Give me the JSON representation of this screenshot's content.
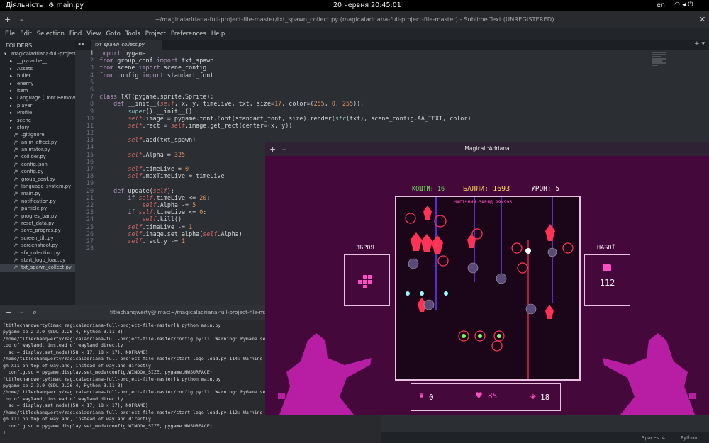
{
  "topbar": {
    "activities": "Діяльність",
    "app": "main.py",
    "clock": "20 червня  20:45:01",
    "lang": "en",
    "tray": "wifi speaker power"
  },
  "sublime": {
    "title": "~/magicaladriana-full-project-file-master/txt_spawn_collect.py (magicaladriana-full-project-file-master) - Sublime Text (UNREGISTERED)",
    "menu": [
      "File",
      "Edit",
      "Selection",
      "Find",
      "View",
      "Goto",
      "Tools",
      "Project",
      "Preferences",
      "Help"
    ],
    "sidebar_header": "FOLDERS",
    "tree": [
      {
        "label": "magicaladriana-full-project-f",
        "icon": "▾",
        "indent": 6
      },
      {
        "label": "__pycache__",
        "icon": "▸",
        "indent": 14
      },
      {
        "label": "Assets",
        "icon": "▸",
        "indent": 14
      },
      {
        "label": "bullet",
        "icon": "▸",
        "indent": 14
      },
      {
        "label": "enemy",
        "icon": "▸",
        "indent": 14
      },
      {
        "label": "item",
        "icon": "▸",
        "indent": 14
      },
      {
        "label": "Language (Dont Remove)",
        "icon": "▸",
        "indent": 14
      },
      {
        "label": "player",
        "icon": "▸",
        "indent": 14
      },
      {
        "label": "Profile",
        "icon": "▸",
        "indent": 14
      },
      {
        "label": "scene",
        "icon": "▸",
        "indent": 14
      },
      {
        "label": "story",
        "icon": "▸",
        "indent": 14
      },
      {
        "label": ".gitignore",
        "icon": "/*",
        "indent": 20
      },
      {
        "label": "anim_effect.py",
        "icon": "/*",
        "indent": 20
      },
      {
        "label": "animator.py",
        "icon": "/*",
        "indent": 20
      },
      {
        "label": "collider.py",
        "icon": "/*",
        "indent": 20
      },
      {
        "label": "config.json",
        "icon": "/*",
        "indent": 20
      },
      {
        "label": "config.py",
        "icon": "/*",
        "indent": 20
      },
      {
        "label": "group_conf.py",
        "icon": "/*",
        "indent": 20
      },
      {
        "label": "language_system.py",
        "icon": "/*",
        "indent": 20
      },
      {
        "label": "main.py",
        "icon": "/*",
        "indent": 20
      },
      {
        "label": "notification.py",
        "icon": "/*",
        "indent": 20
      },
      {
        "label": "particle.py",
        "icon": "/*",
        "indent": 20
      },
      {
        "label": "progres_bar.py",
        "icon": "/*",
        "indent": 20
      },
      {
        "label": "reset_data.py",
        "icon": "/*",
        "indent": 20
      },
      {
        "label": "save_progres.py",
        "icon": "/*",
        "indent": 20
      },
      {
        "label": "screen_tilt.py",
        "icon": "/*",
        "indent": 20
      },
      {
        "label": "screenshoot.py",
        "icon": "/*",
        "indent": 20
      },
      {
        "label": "sfx_colection.py",
        "icon": "/*",
        "indent": 20
      },
      {
        "label": "start_logo_load.py",
        "icon": "/*",
        "indent": 20
      },
      {
        "label": "txt_spawn_collect.py",
        "icon": "/*",
        "indent": 20,
        "selected": true
      }
    ],
    "tab": "txt_spawn_collect.py",
    "line_numbers": [
      "1",
      "2",
      "3",
      "4",
      "5",
      "6",
      "7",
      "8",
      "9",
      "10",
      "11",
      "12",
      "13",
      "14",
      "15",
      "16",
      "17",
      "18",
      "19",
      "20",
      "21",
      "22",
      "23",
      "24",
      "25",
      "26",
      "27",
      "28"
    ],
    "code": [
      "import pygame",
      "from group_conf import txt_spawn",
      "from scene import scene_config",
      "from config import standart_font",
      "",
      "",
      "class TXT(pygame.sprite.Sprite):",
      "    def __init__(self, x, y, timeLive, txt, size=17, color=(255, 0, 255)):",
      "        super().__init__()",
      "        self.image = pygame.font.Font(standart_font, size).render(str(txt), scene_config.AA_TEXT, color)",
      "        self.rect = self.image.get_rect(center=(x, y))",
      "",
      "        self.add(txt_spawn)",
      "",
      "        self.Alpha = 325",
      "",
      "        self.timeLive = 0",
      "        self.maxTimeLive = timeLive",
      "",
      "    def update(self):",
      "        if self.timeLive <= 20:",
      "            self.Alpha -= 5",
      "        if self.timeLive <= 0:",
      "            self.kill()",
      "        self.timeLive -= 1",
      "        self.image.set_alpha(self.Alpha)",
      "        self.rect.y -= 1",
      ""
    ],
    "status": {
      "spaces": "Spaces: 4",
      "syntax": "Python"
    }
  },
  "terminal": {
    "title": "titlechanqwerty@imac:~/magicaladriana-full-project-file-master",
    "lines": [
      "[titlechanqwerty@imac magicaladriana-full-project-file-master]$ python main.py",
      "pygame-ce 2.3.0 (SDL 2.26.4, Python 3.11.3)",
      "/home/titlechanqwerty/magicaladriana-full-project-file-master/config.py:11: Warning: PyGame seems to be running through X11 on",
      "top of wayland, instead of wayland directly",
      "  sc = display.set_mode((58 × 17, 18 × 17), NOFRAME)",
      "/home/titlechanqwerty/magicaladriana-full-project-file-master/start_logo_load.py:114: Warning: PyGame seems to be running throu",
      "gh X11 on top of wayland, instead of wayland directly",
      "  config.sc = pygame.display.set_mode(config.WINDOW_SIZE, pygame.HWSURFACE)",
      "[titlechanqwerty@imac magicaladriana-full-project-file-master]$ python main.py",
      "pygame-ce 2.3.0 (SDL 2.26.4, Python 3.11.3)",
      "/home/titlechanqwerty/magicaladriana-full-project-file-master/config.py:11: Warning: PyGame seems to be running through X11 on",
      "top of wayland, instead of wayland directly",
      "  sc = display.set_mode((58 × 17, 18 × 17), NOFRAME)",
      "/home/titlechanqwerty/magicaladriana-full-project-file-master/start_logo_load.py:112: Warning: PyGame seems to be running throu",
      "gh X11 on top of wayland, instead of wayland directly",
      "  config.sc = pygame.display.set_mode(config.WINDOW_SIZE, pygame.HWSURFACE)",
      "▯"
    ]
  },
  "game": {
    "title": "Magical::Adriana",
    "money_label": "КОШТИ: 16",
    "score_label": "БАЛЛИ: 1693",
    "damage_label": "УРОН: 5",
    "magic_charge": "МАГІЧНИЙ ЗАРЯД  99\\995",
    "weapon_label": "ЗБРОЯ",
    "ammo_label": "НАБОЇ",
    "ammo_value": "112",
    "stat1": "0",
    "stat2": "85",
    "stat3": "18",
    "colors": {
      "bg": "#44083a",
      "field": "#1a0618",
      "accent": "#ff4dc4",
      "silhouette": "#b81ea3"
    }
  }
}
